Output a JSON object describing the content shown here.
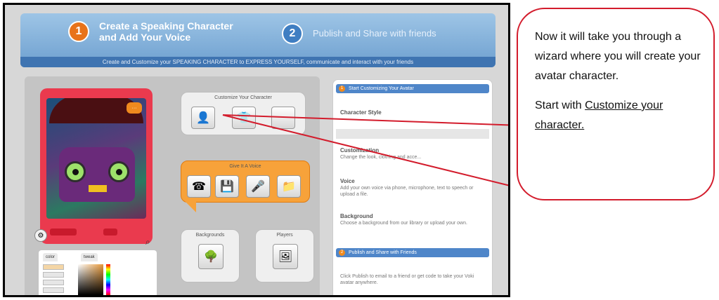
{
  "banner": {
    "step1_num": "1",
    "step1_text": "Create a Speaking Character\nand Add Your Voice",
    "step2_num": "2",
    "step2_text": "Publish and Share with friends",
    "tagline": "Create and Customize your SPEAKING CHARACTER to EXPRESS YOURSELF, communicate and interact with your friends"
  },
  "editor": {
    "customize_title": "Customize Your Character",
    "voice_title": "Give It A Voice",
    "backgrounds_title": "Backgrounds",
    "players_title": "Players",
    "color_tabs": [
      "color",
      "tweak"
    ]
  },
  "sidebar": {
    "head1_num": "1",
    "head1": "Start Customizing Your Avatar",
    "sections": [
      {
        "title": "Character Style",
        "desc": ""
      },
      {
        "title": "Customization",
        "desc": "Change the look, clothing and acce..."
      },
      {
        "title": "Voice",
        "desc": "Add your own voice via phone, microphone, text to speech or upload a file."
      },
      {
        "title": "Background",
        "desc": "Choose a background from our library or upload your own."
      }
    ],
    "head2_num": "2",
    "head2": "Publish and Share with Friends",
    "publish_text": "Click Publish to email to a friend or get code to take your Voki avatar anywhere."
  },
  "callout": {
    "para1": "Now it will take you through a wizard where you will create your avatar character.",
    "para2_prefix": "Start with ",
    "para2_link": "Customize your character."
  },
  "colors": {
    "accent_orange": "#f7a23a",
    "banner_blue": "#6d9fcf",
    "callout_red": "#d31c2c",
    "avatar_frame": "#ea3a4e"
  },
  "icons": [
    "person-icon",
    "clothing-icon",
    "blank-icon",
    "phone-icon",
    "computer-icon",
    "microphone-icon",
    "folder-icon",
    "tree-icon",
    "player-icon"
  ]
}
